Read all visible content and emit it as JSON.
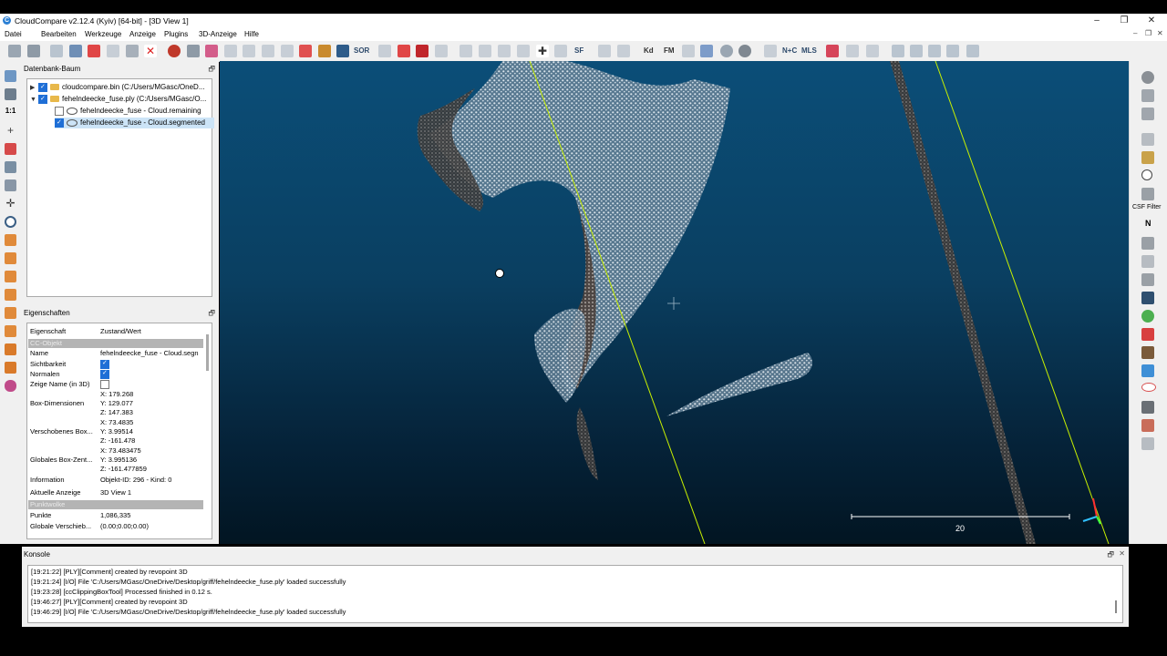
{
  "window": {
    "title": "CloudCompare v2.12.4 (Kyiv) [64-bit] - [3D View 1]",
    "icon_letter": "C"
  },
  "menu": [
    "Datei",
    "Bearbeiten",
    "Werkzeuge",
    "Anzeige",
    "Plugins",
    "3D-Anzeige",
    "Hilfe"
  ],
  "toolbar": {
    "sor_label": "SOR",
    "sf_label": "SF",
    "kd_label": "Kd",
    "fm_label": "FM",
    "nc_label": "N+C",
    "mls_label": "MLS"
  },
  "leftbar": {
    "scale_label": "1:1"
  },
  "rightbar": {
    "csf_label": "CSF Filter",
    "n_label": "N"
  },
  "db_panel": {
    "title": "Datenbank-Baum",
    "items": [
      {
        "label": "cloudcompare.bin (C:/Users/MGasc/OneD..."
      },
      {
        "label": "fehelndeecke_fuse.ply (C:/Users/MGasc/O..."
      },
      {
        "label": "fehelndeecke_fuse - Cloud.remaining"
      },
      {
        "label": "fehelndeecke_fuse - Cloud.segmented"
      }
    ]
  },
  "properties_panel": {
    "title": "Eigenschaften",
    "header": {
      "key": "Eigenschaft",
      "value": "Zustand/Wert"
    },
    "section_cc": "CC-Objekt",
    "name": {
      "key": "Name",
      "value": "fehelndeecke_fuse - Cloud.segn"
    },
    "visibility": {
      "key": "Sichtbarkeit"
    },
    "normals": {
      "key": "Normalen"
    },
    "show_name": {
      "key": "Zeige Name (in 3D)"
    },
    "box_dims": {
      "key": "Box-Dimensionen",
      "x": "X: 179.268",
      "y": "Y: 129.077",
      "z": "Z: 147.383"
    },
    "shifted_box": {
      "key": "Verschobenes Box...",
      "x": "X: 73.4835",
      "y": "Y: 3.99514",
      "z": "Z: -161.478"
    },
    "global_box": {
      "key": "Globales Box-Zent...",
      "x": "X: 73.483475",
      "y": "Y: 3.995136",
      "z": "Z: -161.477859"
    },
    "information": {
      "key": "Information",
      "value": "Objekt-ID: 296 - Kind: 0"
    },
    "current_view": {
      "key": "Aktuelle Anzeige",
      "value": "3D View 1"
    },
    "section_cloud": "Punktwolke",
    "points": {
      "key": "Punkte",
      "value": "1,086,335"
    },
    "global_shift": {
      "key": "Globale Verschieb...",
      "value": "(0.00;0.00;0.00)"
    }
  },
  "viewport": {
    "scale_value": "20"
  },
  "console": {
    "title": "Konsole",
    "lines": [
      "[19:21:22] [PLY][Comment] created by revopoint 3D",
      "[19:21:24] [I/O] File 'C:/Users/MGasc/OneDrive/Desktop/griff/fehelndeecke_fuse.ply' loaded successfully",
      "[19:23:28] [ccClippingBoxTool] Processed finished in 0.12 s.",
      "[19:46:27] [PLY][Comment] created by revopoint 3D",
      "[19:46:29] [I/O] File 'C:/Users/MGasc/OneDrive/Desktop/griff/fehelndeecke_fuse.ply' loaded successfully"
    ]
  }
}
